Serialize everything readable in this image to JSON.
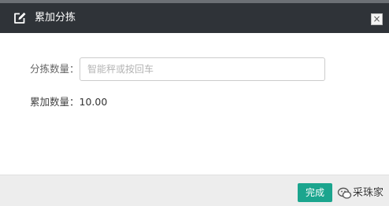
{
  "dialog": {
    "title": "累加分拣",
    "close_symbol": "×",
    "edit_icon": "edit-icon"
  },
  "form": {
    "sort_qty_label": "分拣数量：",
    "sort_qty_placeholder": "智能秤或按回车",
    "total_label": "累加数量：",
    "total_value": "10.00"
  },
  "footer": {
    "done_label": "完成",
    "watermark_text": "采珠家",
    "watermark_icon": "wechat-icon"
  },
  "colors": {
    "titlebar": "#2f3338",
    "done_button": "#1ba58e"
  }
}
